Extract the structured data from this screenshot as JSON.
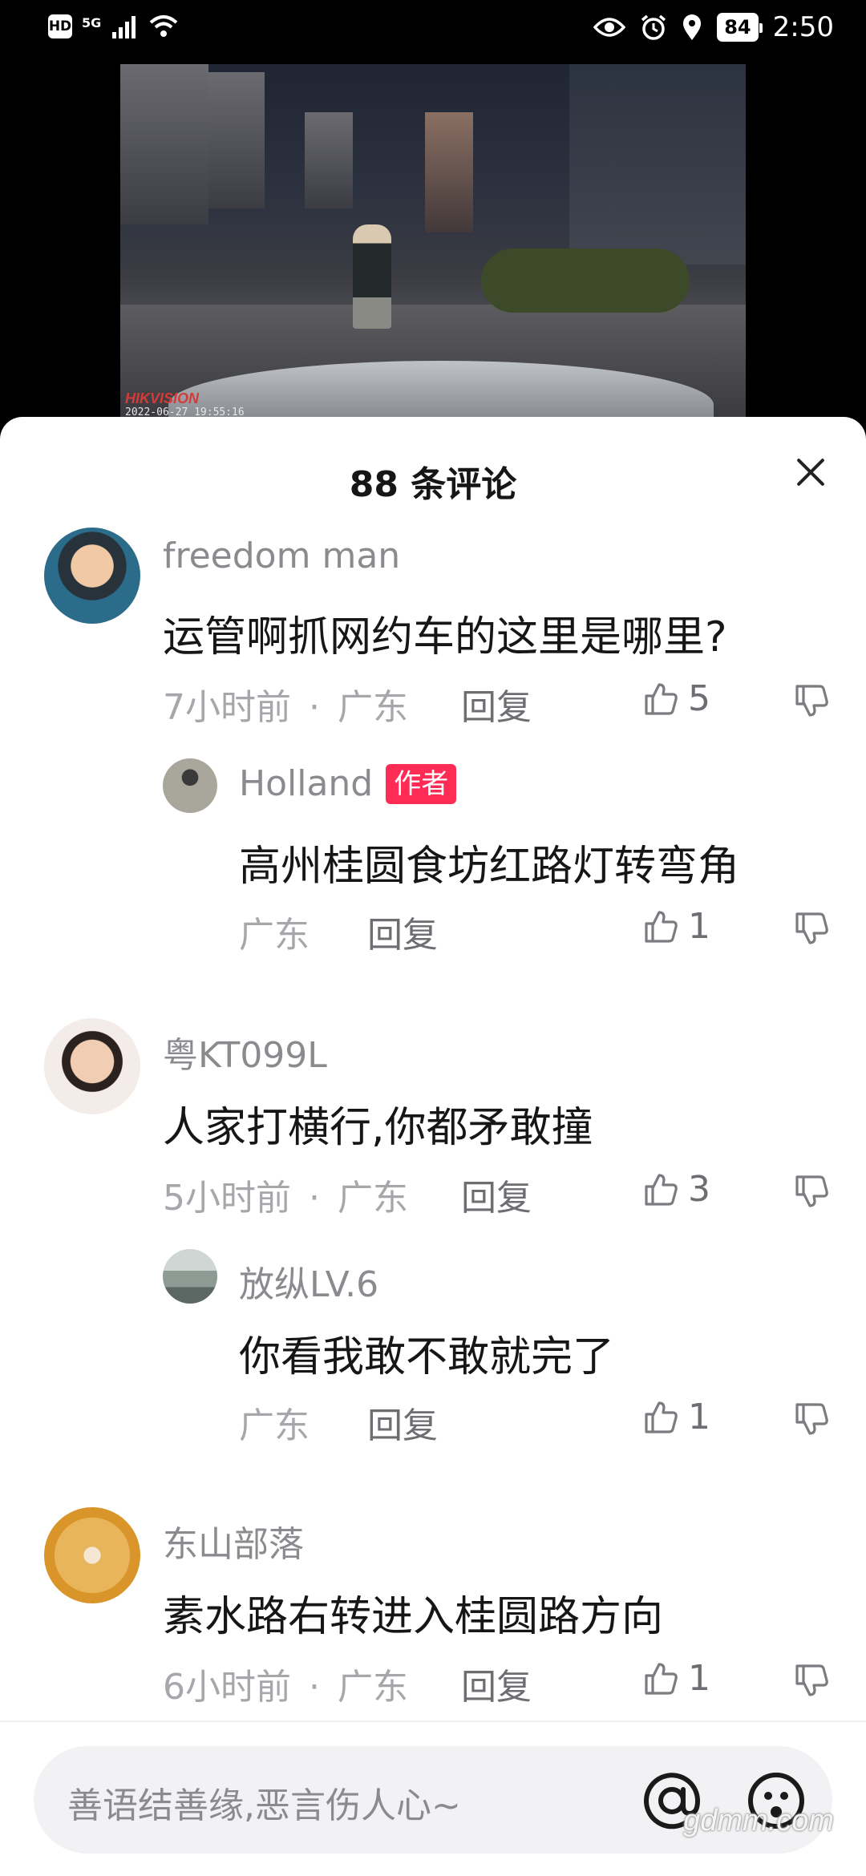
{
  "status_bar": {
    "hd": "HD",
    "network": "5G",
    "battery": "84",
    "time": "2:50"
  },
  "video": {
    "brand_watermark": "HIKVISION",
    "timestamp": "2022-06-27    19:55:16"
  },
  "sheet": {
    "title": "88 条评论"
  },
  "comments": [
    {
      "username": "freedom man",
      "text": "运管啊抓网约车的这里是哪里?",
      "time": "7小时前",
      "sep": "·",
      "region": "广东",
      "reply": "回复",
      "likes": "5",
      "avatar_color": "#2a6c8a",
      "reply_to": {
        "username": "Holland",
        "badge": "作者",
        "text": "高州桂圆食坊红路灯转弯角",
        "region": "广东",
        "reply": "回复",
        "likes": "1",
        "avatar_color": "#8d8a7c"
      }
    },
    {
      "username": "粤KT099L",
      "text": "人家打横行,你都矛敢撞",
      "time": "5小时前",
      "sep": "·",
      "region": "广东",
      "reply": "回复",
      "likes": "3",
      "avatar_color": "#e9c7b3",
      "reply_to": {
        "username": "放纵LV.6",
        "text": "你看我敢不敢就完了",
        "region": "广东",
        "reply": "回复",
        "likes": "1",
        "avatar_color": "#7f8d88"
      }
    },
    {
      "username": "东山部落",
      "text": "素水路右转进入桂圆路方向",
      "time": "6小时前",
      "sep": "·",
      "region": "广东",
      "reply": "回复",
      "likes": "1",
      "avatar_color": "#e0a23a"
    }
  ],
  "input": {
    "placeholder": "善语结善缘,恶言伤人心~"
  },
  "watermark_site": "gdmm.com",
  "icons": [
    "signal-icon",
    "wifi-icon",
    "eye-icon",
    "alarm-icon",
    "location-icon",
    "battery-icon",
    "close-icon",
    "thumb-up-icon",
    "thumb-down-icon",
    "at-icon",
    "emoji-icon"
  ]
}
